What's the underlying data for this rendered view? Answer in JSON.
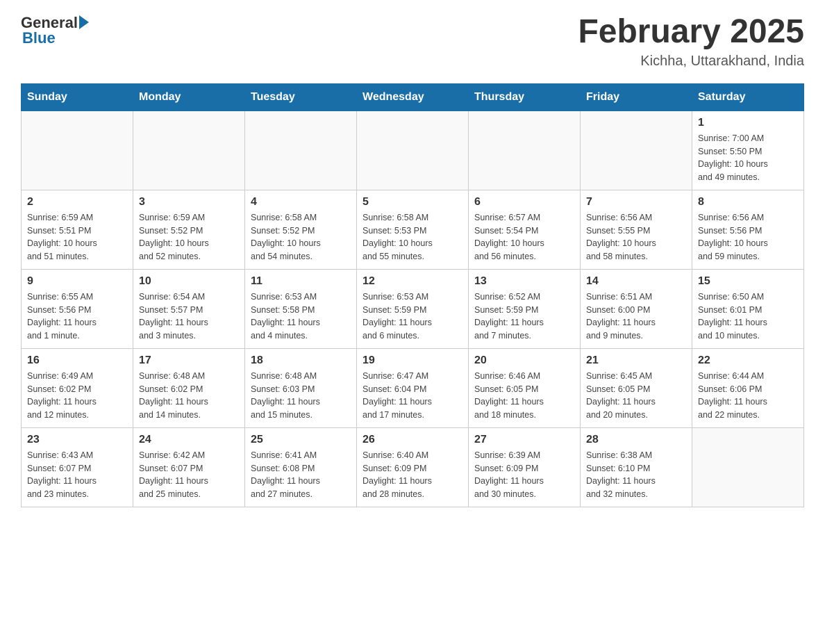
{
  "header": {
    "logo": {
      "general": "General",
      "blue": "Blue"
    },
    "title": "February 2025",
    "location": "Kichha, Uttarakhand, India"
  },
  "weekdays": [
    "Sunday",
    "Monday",
    "Tuesday",
    "Wednesday",
    "Thursday",
    "Friday",
    "Saturday"
  ],
  "weeks": [
    [
      {
        "day": "",
        "info": ""
      },
      {
        "day": "",
        "info": ""
      },
      {
        "day": "",
        "info": ""
      },
      {
        "day": "",
        "info": ""
      },
      {
        "day": "",
        "info": ""
      },
      {
        "day": "",
        "info": ""
      },
      {
        "day": "1",
        "info": "Sunrise: 7:00 AM\nSunset: 5:50 PM\nDaylight: 10 hours\nand 49 minutes."
      }
    ],
    [
      {
        "day": "2",
        "info": "Sunrise: 6:59 AM\nSunset: 5:51 PM\nDaylight: 10 hours\nand 51 minutes."
      },
      {
        "day": "3",
        "info": "Sunrise: 6:59 AM\nSunset: 5:52 PM\nDaylight: 10 hours\nand 52 minutes."
      },
      {
        "day": "4",
        "info": "Sunrise: 6:58 AM\nSunset: 5:52 PM\nDaylight: 10 hours\nand 54 minutes."
      },
      {
        "day": "5",
        "info": "Sunrise: 6:58 AM\nSunset: 5:53 PM\nDaylight: 10 hours\nand 55 minutes."
      },
      {
        "day": "6",
        "info": "Sunrise: 6:57 AM\nSunset: 5:54 PM\nDaylight: 10 hours\nand 56 minutes."
      },
      {
        "day": "7",
        "info": "Sunrise: 6:56 AM\nSunset: 5:55 PM\nDaylight: 10 hours\nand 58 minutes."
      },
      {
        "day": "8",
        "info": "Sunrise: 6:56 AM\nSunset: 5:56 PM\nDaylight: 10 hours\nand 59 minutes."
      }
    ],
    [
      {
        "day": "9",
        "info": "Sunrise: 6:55 AM\nSunset: 5:56 PM\nDaylight: 11 hours\nand 1 minute."
      },
      {
        "day": "10",
        "info": "Sunrise: 6:54 AM\nSunset: 5:57 PM\nDaylight: 11 hours\nand 3 minutes."
      },
      {
        "day": "11",
        "info": "Sunrise: 6:53 AM\nSunset: 5:58 PM\nDaylight: 11 hours\nand 4 minutes."
      },
      {
        "day": "12",
        "info": "Sunrise: 6:53 AM\nSunset: 5:59 PM\nDaylight: 11 hours\nand 6 minutes."
      },
      {
        "day": "13",
        "info": "Sunrise: 6:52 AM\nSunset: 5:59 PM\nDaylight: 11 hours\nand 7 minutes."
      },
      {
        "day": "14",
        "info": "Sunrise: 6:51 AM\nSunset: 6:00 PM\nDaylight: 11 hours\nand 9 minutes."
      },
      {
        "day": "15",
        "info": "Sunrise: 6:50 AM\nSunset: 6:01 PM\nDaylight: 11 hours\nand 10 minutes."
      }
    ],
    [
      {
        "day": "16",
        "info": "Sunrise: 6:49 AM\nSunset: 6:02 PM\nDaylight: 11 hours\nand 12 minutes."
      },
      {
        "day": "17",
        "info": "Sunrise: 6:48 AM\nSunset: 6:02 PM\nDaylight: 11 hours\nand 14 minutes."
      },
      {
        "day": "18",
        "info": "Sunrise: 6:48 AM\nSunset: 6:03 PM\nDaylight: 11 hours\nand 15 minutes."
      },
      {
        "day": "19",
        "info": "Sunrise: 6:47 AM\nSunset: 6:04 PM\nDaylight: 11 hours\nand 17 minutes."
      },
      {
        "day": "20",
        "info": "Sunrise: 6:46 AM\nSunset: 6:05 PM\nDaylight: 11 hours\nand 18 minutes."
      },
      {
        "day": "21",
        "info": "Sunrise: 6:45 AM\nSunset: 6:05 PM\nDaylight: 11 hours\nand 20 minutes."
      },
      {
        "day": "22",
        "info": "Sunrise: 6:44 AM\nSunset: 6:06 PM\nDaylight: 11 hours\nand 22 minutes."
      }
    ],
    [
      {
        "day": "23",
        "info": "Sunrise: 6:43 AM\nSunset: 6:07 PM\nDaylight: 11 hours\nand 23 minutes."
      },
      {
        "day": "24",
        "info": "Sunrise: 6:42 AM\nSunset: 6:07 PM\nDaylight: 11 hours\nand 25 minutes."
      },
      {
        "day": "25",
        "info": "Sunrise: 6:41 AM\nSunset: 6:08 PM\nDaylight: 11 hours\nand 27 minutes."
      },
      {
        "day": "26",
        "info": "Sunrise: 6:40 AM\nSunset: 6:09 PM\nDaylight: 11 hours\nand 28 minutes."
      },
      {
        "day": "27",
        "info": "Sunrise: 6:39 AM\nSunset: 6:09 PM\nDaylight: 11 hours\nand 30 minutes."
      },
      {
        "day": "28",
        "info": "Sunrise: 6:38 AM\nSunset: 6:10 PM\nDaylight: 11 hours\nand 32 minutes."
      },
      {
        "day": "",
        "info": ""
      }
    ]
  ]
}
